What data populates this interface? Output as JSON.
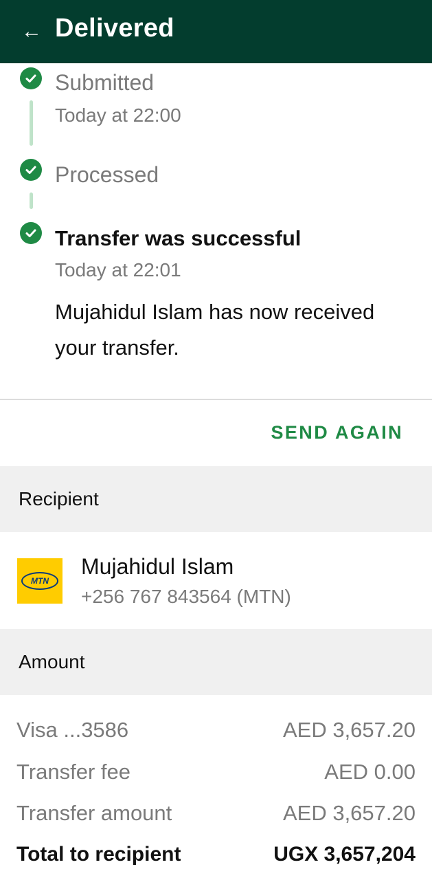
{
  "header": {
    "title": "Delivered"
  },
  "timeline": {
    "steps": [
      {
        "label": "Submitted",
        "time": "Today at 22:00"
      },
      {
        "label": "Processed"
      },
      {
        "label": "Transfer was successful",
        "time": "Today at 22:01",
        "description": "Mujahidul Islam has now received your transfer."
      }
    ]
  },
  "actions": {
    "send_again": "SEND AGAIN"
  },
  "recipient": {
    "section_title": "Recipient",
    "name": "Mujahidul Islam",
    "phone": "+256 767 843564 (MTN)",
    "logo_text": "MTN"
  },
  "amount": {
    "section_title": "Amount",
    "rows": [
      {
        "label": "Visa ...3586",
        "value": "AED 3,657.20"
      },
      {
        "label": "Transfer fee",
        "value": "AED 0.00"
      },
      {
        "label": "Transfer amount",
        "value": "AED 3,657.20"
      },
      {
        "label": "Total to recipient",
        "value": "UGX 3,657,204"
      }
    ]
  },
  "colors": {
    "appbar": "#033d2e",
    "accent": "#1f8a45",
    "timeline_line": "#bfe3c9"
  }
}
